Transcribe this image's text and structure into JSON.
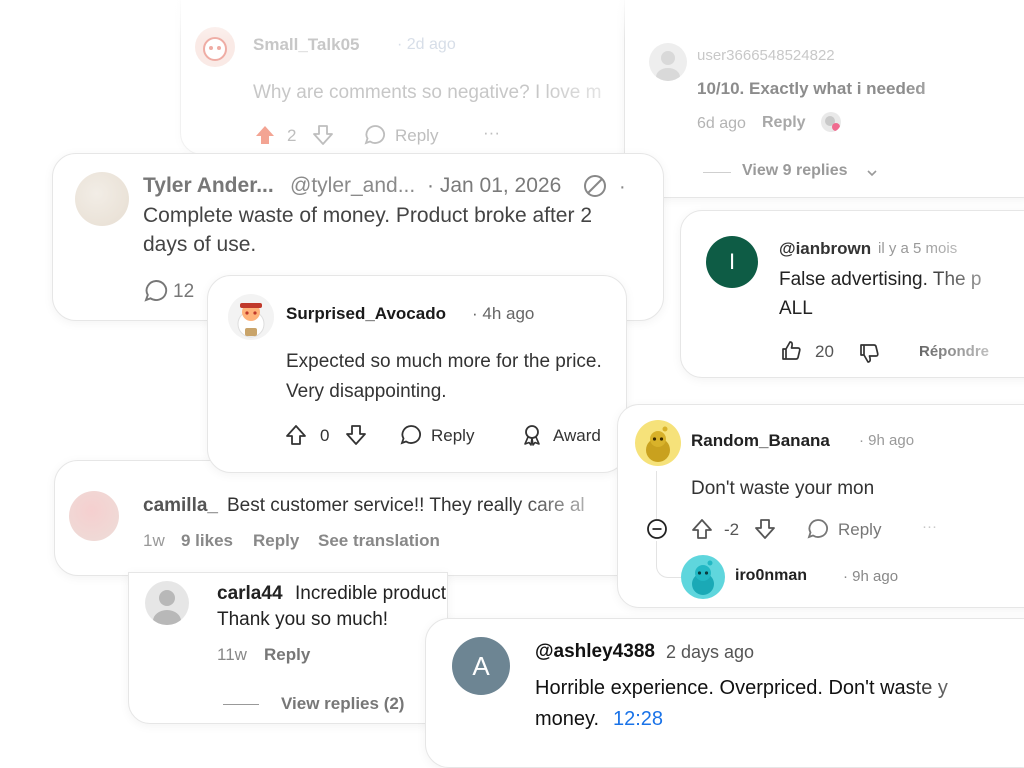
{
  "c1": {
    "user": "Small_Talk05",
    "time": "· 2d ago",
    "text": "Why are comments so negative? I love m",
    "votes": "2",
    "reply": "Reply",
    "more": "···"
  },
  "c2": {
    "user": "user3666548524822",
    "text": "10/10. Exactly what i needed",
    "time": "6d ago",
    "reply": "Reply",
    "view": "View 9 replies"
  },
  "c3": {
    "name": "Tyler Ander...",
    "handle": "@tyler_and...",
    "date": "· Jan 01, 2026",
    "text_a": "Complete waste of money. Product broke after 2",
    "text_b": "days of use.",
    "comments": "12"
  },
  "c4": {
    "user": "@ianbrown",
    "time": "il y a 5 mois",
    "avatar_letter": "I",
    "text_a": "False advertising. The p",
    "text_b": "ALL",
    "likes": "20",
    "reply": "Répondre",
    "avatar_color": "#0e5c45"
  },
  "c5": {
    "user": "Surprised_Avocado",
    "time": "· 4h ago",
    "text_a": "Expected so much more for the price.",
    "text_b": "Very disappointing.",
    "votes": "0",
    "reply": "Reply",
    "award": "Award"
  },
  "c6": {
    "user": "Random_Banana",
    "time": "· 9h ago",
    "text": "Don't waste your mon",
    "votes": "-2",
    "reply": "Reply",
    "more": "···",
    "sub_user": "iro0nman",
    "sub_time": "· 9h ago"
  },
  "c7": {
    "user": "camilla_",
    "text": "Best customer service!! They really care al",
    "time": "1w",
    "likes": "9 likes",
    "reply": "Reply",
    "translate": "See translation"
  },
  "c8": {
    "user": "carla44",
    "text_a": "Incredible product! Exactly what I w",
    "text_b": "Thank you so much!",
    "time": "11w",
    "reply": "Reply",
    "view": "View replies (2)"
  },
  "c9": {
    "user": "@ashley4388",
    "time": "2 days ago",
    "avatar_letter": "A",
    "text_a": "Horrible experience. Overpriced. Don't waste y",
    "text_b": "money.",
    "timestamp": "12:28",
    "avatar_color": "#6d8593",
    "link_color": "#1a73e8"
  },
  "icons": [
    "upvote-icon",
    "downvote-icon",
    "reply-bubble-icon",
    "award-icon",
    "collapse-icon",
    "like-thumb-icon",
    "dislike-thumb-icon",
    "no-symbol-icon",
    "chevron-down-icon",
    "comment-bubble-icon"
  ]
}
